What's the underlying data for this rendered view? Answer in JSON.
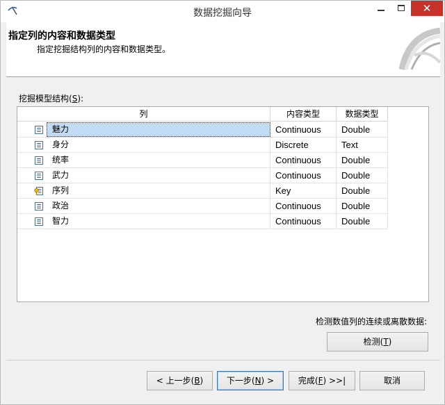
{
  "window": {
    "title": "数据挖掘向导",
    "close_glyph": "✕"
  },
  "header": {
    "title": "指定列的内容和数据类型",
    "subtitle": "指定挖掘结构列的内容和数据类型。"
  },
  "grid": {
    "label_pre": "挖掘模型结构(",
    "label_key": "S",
    "label_post": "):",
    "columns": [
      "列",
      "内容类型",
      "数据类型"
    ],
    "rows": [
      {
        "name": "魅力",
        "content_type": "Continuous",
        "data_type": "Double",
        "icon": "column-icon",
        "selected": true
      },
      {
        "name": "身分",
        "content_type": "Discrete",
        "data_type": "Text",
        "icon": "column-icon",
        "selected": false
      },
      {
        "name": "统率",
        "content_type": "Continuous",
        "data_type": "Double",
        "icon": "column-icon",
        "selected": false
      },
      {
        "name": "武力",
        "content_type": "Continuous",
        "data_type": "Double",
        "icon": "column-icon",
        "selected": false
      },
      {
        "name": "序列",
        "content_type": "Key",
        "data_type": "Double",
        "icon": "key-column-icon",
        "selected": false
      },
      {
        "name": "政治",
        "content_type": "Continuous",
        "data_type": "Double",
        "icon": "column-icon",
        "selected": false
      },
      {
        "name": "智力",
        "content_type": "Continuous",
        "data_type": "Double",
        "icon": "column-icon",
        "selected": false
      }
    ]
  },
  "detect": {
    "label": "检测数值列的连续或离散数据:",
    "button_pre": "检测(",
    "button_key": "T",
    "button_post": ")"
  },
  "footer": {
    "back_pre": "< 上一步(",
    "back_key": "B",
    "back_post": ")",
    "next_pre": "下一步(",
    "next_key": "N",
    "next_post": ") >",
    "finish_pre": "完成(",
    "finish_key": "F",
    "finish_post": ") >>|",
    "cancel": "取消"
  }
}
